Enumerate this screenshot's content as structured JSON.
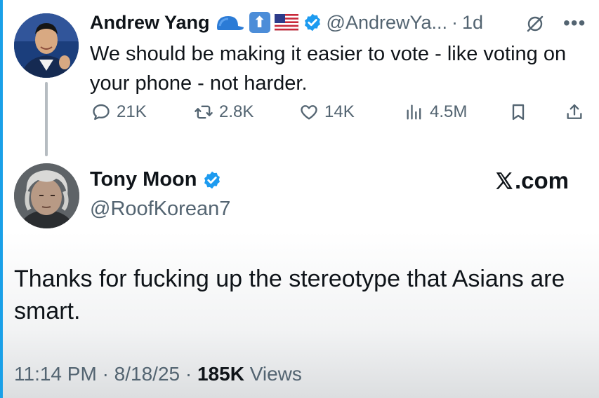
{
  "tweet1": {
    "author_name": "Andrew Yang",
    "verified": true,
    "handle": "@AndrewYa...",
    "separator": "·",
    "time": "1d",
    "text": "We should be making it easier to vote - like voting on your phone - not harder.",
    "icons": [
      "blue-cap-emoji",
      "up-arrow-emoji",
      "us-flag-emoji",
      "verified-badge-icon",
      "nullified-icon",
      "more-icon"
    ],
    "actions": {
      "replies": "21K",
      "reposts": "2.8K",
      "likes": "14K",
      "views": "4.5M"
    }
  },
  "tweet2": {
    "author_name": "Tony Moon",
    "verified": true,
    "handle": "@RoofKorean7",
    "watermark": ".com",
    "text": "Thanks for fucking up the stereotype that Asians are smart.",
    "meta": {
      "time": "11:14 PM",
      "sep1": "·",
      "date": "8/18/25",
      "sep2": "·",
      "views_count": "185K",
      "views_label": "Views"
    }
  },
  "colors": {
    "text_primary": "#0f1419",
    "text_secondary": "#536471",
    "verified_blue": "#1d9bf0",
    "thread_line": "#b6bcc1"
  }
}
